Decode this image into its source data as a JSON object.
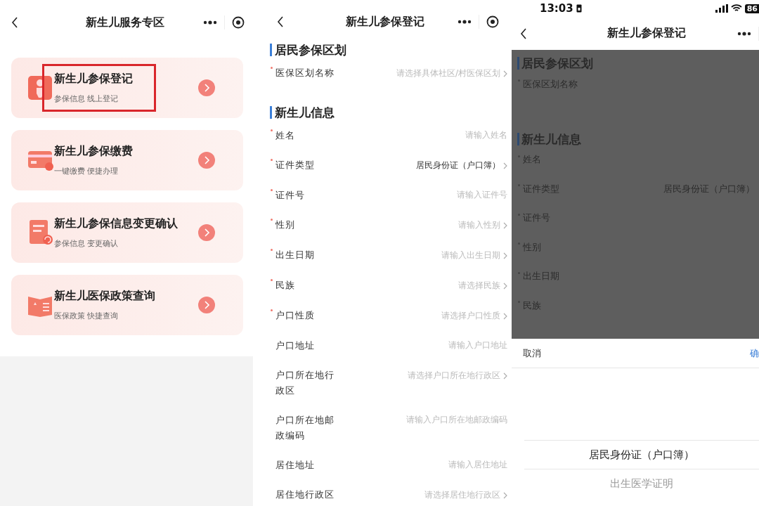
{
  "service_zone": {
    "nav": {
      "title": "新生儿服务专区"
    },
    "cards": [
      {
        "kind": "register",
        "title": "新生儿参保登记",
        "subtitle": "参保信息 线上登记",
        "highlighted": true
      },
      {
        "kind": "payment",
        "title": "新生儿参保缴费",
        "subtitle": "一键缴费 便捷办理",
        "highlighted": false
      },
      {
        "kind": "change",
        "title": "新生儿参保信息变更确认",
        "subtitle": "参保信息 变更确认",
        "highlighted": false
      },
      {
        "kind": "policy",
        "title": "新生儿医保政策查询",
        "subtitle": "医保政策 快捷查询",
        "highlighted": false
      }
    ]
  },
  "registration_form": {
    "nav": {
      "title": "新生儿参保登记"
    },
    "sections": [
      {
        "title": "居民参保区划",
        "rows": [
          {
            "kind": "select",
            "label": "医保区划名称",
            "required": true,
            "placeholder": "请选择具体社区/村医保区划"
          }
        ]
      },
      {
        "title": "新生儿信息",
        "rows": [
          {
            "kind": "input",
            "label": "姓名",
            "required": true,
            "placeholder": "请输入姓名"
          },
          {
            "kind": "select",
            "label": "证件类型",
            "required": true,
            "value": "居民身份证（户口簿）"
          },
          {
            "kind": "input",
            "label": "证件号",
            "required": true,
            "placeholder": "请输入证件号"
          },
          {
            "kind": "select",
            "label": "性别",
            "required": true,
            "placeholder": "请输入性别"
          },
          {
            "kind": "select",
            "label": "出生日期",
            "required": true,
            "placeholder": "请输入出生日期"
          },
          {
            "kind": "select",
            "label": "民族",
            "required": true,
            "placeholder": "请选择民族"
          },
          {
            "kind": "select",
            "label": "户口性质",
            "required": true,
            "placeholder": "请选择户口性质"
          },
          {
            "kind": "input",
            "label": "户口地址",
            "required": false,
            "placeholder": "请输入户口地址"
          },
          {
            "kind": "select",
            "label": "户口所在地行政区",
            "required": false,
            "placeholder": "请选择户口所在地行政区"
          },
          {
            "kind": "input",
            "label": "户口所在地邮政编码",
            "required": false,
            "placeholder": "请输入户口所在地邮政编码"
          },
          {
            "kind": "input",
            "label": "居住地址",
            "required": false,
            "placeholder": "请输入居住地址"
          },
          {
            "kind": "select",
            "label": "居住地行政区",
            "required": false,
            "placeholder": "请选择居住地行政区"
          }
        ]
      }
    ]
  },
  "picker_screen": {
    "status_bar": {
      "time": "13:03",
      "battery": "86"
    },
    "nav": {
      "title": "新生儿参保登记"
    },
    "dimmed_sections": [
      {
        "title": "居民参保区划",
        "rows": [
          {
            "label": "医保区划名称",
            "required": true
          }
        ]
      },
      {
        "title": "新生儿信息",
        "rows": [
          {
            "label": "姓名",
            "required": true
          },
          {
            "label": "证件类型",
            "required": true,
            "value": "居民身份证（户口簿）"
          },
          {
            "label": "证件号",
            "required": true
          },
          {
            "label": "性别",
            "required": true
          },
          {
            "label": "出生日期",
            "required": true
          },
          {
            "label": "民族",
            "required": true
          }
        ]
      }
    ],
    "sheet": {
      "cancel": "取消",
      "confirm": "确",
      "options": [
        {
          "label": "居民身份证（户口簿）",
          "selected": true
        },
        {
          "label": "出生医学证明",
          "selected": false
        }
      ]
    }
  }
}
